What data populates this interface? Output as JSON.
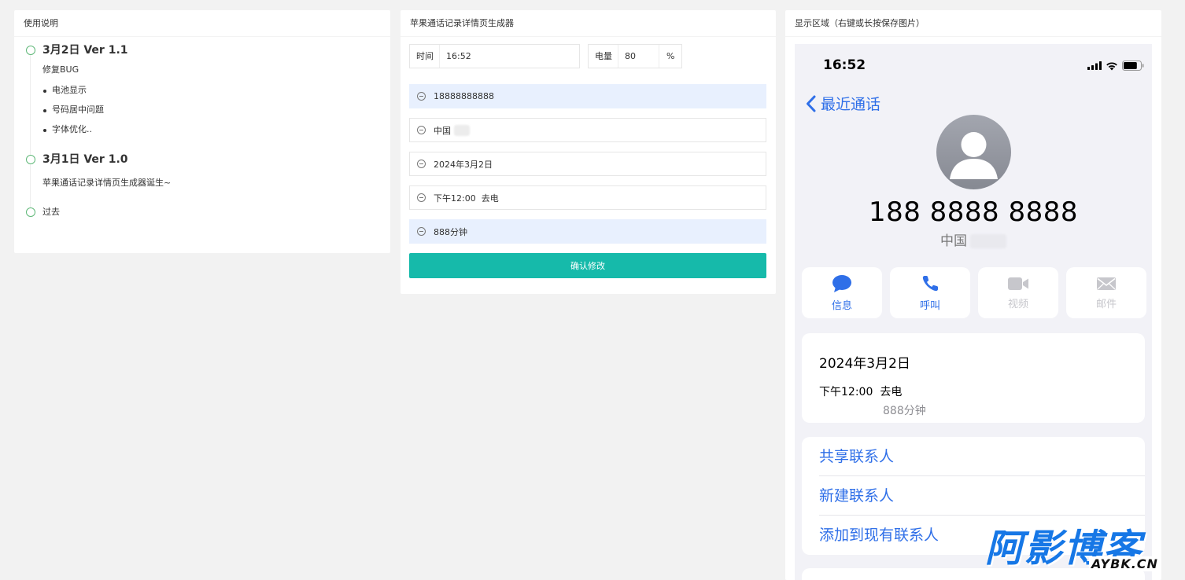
{
  "left_panel": {
    "title": "使用说明",
    "timeline": [
      {
        "title": "3月2日 Ver 1.1",
        "desc": "修复BUG",
        "items": [
          "电池显示",
          "号码居中问题",
          "字体优化.."
        ]
      },
      {
        "title": "3月1日 Ver 1.0",
        "desc": "苹果通话记录详情页生成器诞生~"
      },
      {
        "plain": "过去"
      }
    ]
  },
  "middle_panel": {
    "title": "苹果通话记录详情页生成器",
    "time": {
      "label": "时间",
      "value": "16:52"
    },
    "battery": {
      "label": "电量",
      "value": "80",
      "suffix": "%"
    },
    "fields": {
      "number": "18888888888",
      "location": "中国",
      "date": "2024年3月2日",
      "call_time": "下午12:00  去电",
      "duration": "888分钟"
    },
    "submit_label": "确认修改"
  },
  "right_panel": {
    "title": "显示区域（右键或长按保存图片）",
    "phone": {
      "status_time": "16:52",
      "battery_level": 0.8,
      "back_label": "最近通话",
      "number_display": "188 8888 8888",
      "location": "中国",
      "actions": [
        {
          "label": "信息",
          "icon": "message-icon",
          "enabled": true
        },
        {
          "label": "呼叫",
          "icon": "phone-icon",
          "enabled": true
        },
        {
          "label": "视频",
          "icon": "video-icon",
          "enabled": false
        },
        {
          "label": "邮件",
          "icon": "mail-icon",
          "enabled": false
        }
      ],
      "call": {
        "date": "2024年3月2日",
        "time": "下午12:00",
        "type": "去电",
        "duration": "888分钟"
      },
      "menu": [
        "共享联系人",
        "新建联系人",
        "添加到现有联系人"
      ]
    }
  },
  "watermark": {
    "main": "阿影博客",
    "sub": "AYBK.CN"
  },
  "colors": {
    "accent_teal": "#16baaa",
    "ios_blue": "#2f6fe8",
    "timeline_green": "#5fb878",
    "focus_bg": "#e8f0fe",
    "watermark_blue": "#1677e6"
  }
}
